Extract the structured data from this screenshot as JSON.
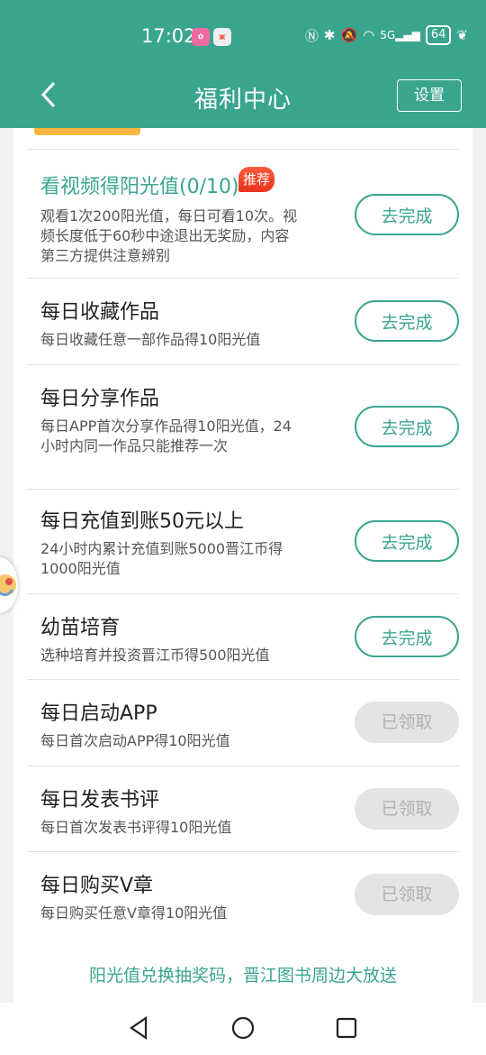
{
  "status_bar": {
    "time": "17:02",
    "battery": "64"
  },
  "header": {
    "title": "福利中心",
    "settings_label": "设置"
  },
  "tasks": [
    {
      "title": "看视频得阳光值(0/10)",
      "badge": "推荐",
      "desc": "观看1次200阳光值，每日可看10次。视频长度低于60秒中途退出无奖励，内容第三方提供注意辨别",
      "button": "去完成",
      "state": "todo"
    },
    {
      "title": "每日收藏作品",
      "desc": "每日收藏任意一部作品得10阳光值",
      "button": "去完成",
      "state": "todo"
    },
    {
      "title": "每日分享作品",
      "desc": "每日APP首次分享作品得10阳光值，24小时内同一作品只能推荐一次",
      "button": "去完成",
      "state": "todo"
    },
    {
      "title": "每日充值到账50元以上",
      "desc": "24小时内累计充值到账5000晋江币得1000阳光值",
      "button": "去完成",
      "state": "todo"
    },
    {
      "title": "幼苗培育",
      "desc": "选种培育并投资晋江币得500阳光值",
      "button": "去完成",
      "state": "todo"
    },
    {
      "title": "每日启动APP",
      "desc": "每日首次启动APP得10阳光值",
      "button": "已领取",
      "state": "done"
    },
    {
      "title": "每日发表书评",
      "desc": "每日首次发表书评得10阳光值",
      "button": "已领取",
      "state": "done"
    },
    {
      "title": "每日购买V章",
      "desc": "每日购买任意V章得10阳光值",
      "button": "已领取",
      "state": "done"
    }
  ],
  "footer": {
    "text": "阳光值兑换抽奖码，晋江图书周边大放送"
  },
  "colors": {
    "accent": "#3aa58f",
    "tab_indicator": "#f6b53c",
    "badge": "#e8341c"
  }
}
